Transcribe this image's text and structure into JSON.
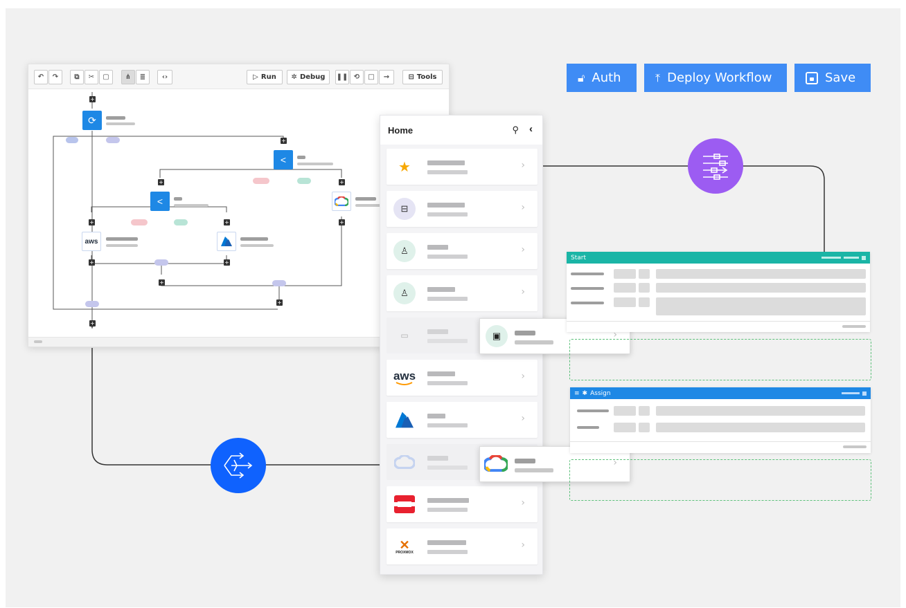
{
  "actions": {
    "auth_label": "Auth",
    "deploy_label": "Deploy Workflow",
    "save_label": "Save"
  },
  "editor": {
    "toolbar": {
      "run_label": "Run",
      "debug_label": "Debug",
      "tools_label": "Tools"
    },
    "nodes": {
      "aws_logo_text": "aws"
    }
  },
  "catalog": {
    "title": "Home",
    "items": [
      {
        "icon": "star-icon"
      },
      {
        "icon": "lego-block-icon"
      },
      {
        "icon": "user-settings-icon"
      },
      {
        "icon": "user-icon"
      },
      {
        "icon": "folder-user-icon"
      },
      {
        "icon": "aws-logo",
        "logo_text": "aws"
      },
      {
        "icon": "azure-logo"
      },
      {
        "icon": "google-cloud-logo"
      },
      {
        "icon": "openstack-logo"
      },
      {
        "icon": "proxmox-logo",
        "logo_text": "PROXMOX"
      }
    ]
  },
  "forms": {
    "start_title": "Start",
    "assign_title": "Assign"
  },
  "colors": {
    "accent_blue": "#3f8cf5",
    "node_blue": "#1e88e5",
    "teal_header": "#1ab5a6",
    "assign_header": "#1e88e5",
    "purple_circle": "#9c5cf2",
    "blue_circle": "#0f62fe",
    "dashed_green": "#5cc07a"
  }
}
